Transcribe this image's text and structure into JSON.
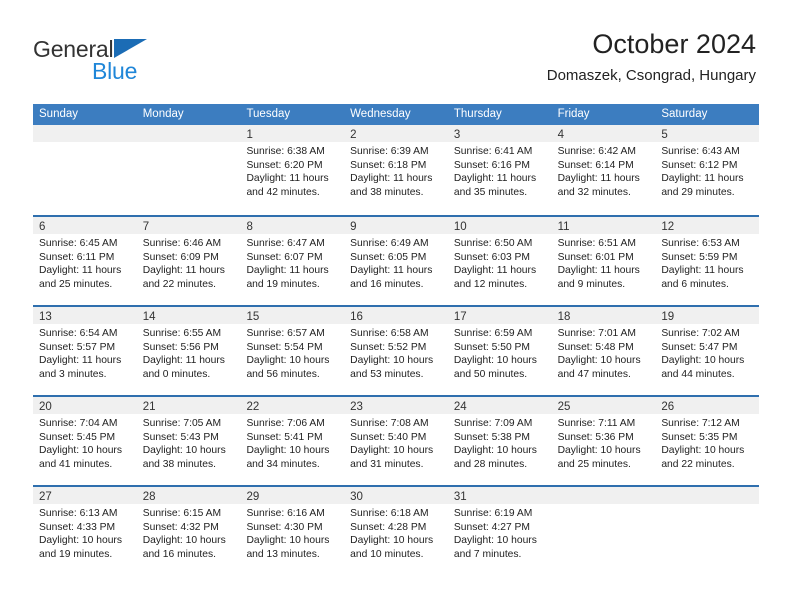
{
  "brand": {
    "name_part1": "General",
    "name_part2": "Blue",
    "triangle_color": "#1b6cb5",
    "blue_color": "#1f86d8"
  },
  "header": {
    "title": "October 2024",
    "subtitle": "Domaszek, Csongrad, Hungary"
  },
  "theme": {
    "header_bar_color": "#3c7dc0",
    "row_divider_color": "#2f6fae",
    "day_strip_color": "#f0f0f0",
    "text_color": "#222222"
  },
  "weekdays": [
    "Sunday",
    "Monday",
    "Tuesday",
    "Wednesday",
    "Thursday",
    "Friday",
    "Saturday"
  ],
  "weeks": [
    [
      {
        "day": "",
        "lines": []
      },
      {
        "day": "",
        "lines": []
      },
      {
        "day": "1",
        "lines": [
          "Sunrise: 6:38 AM",
          "Sunset: 6:20 PM",
          "Daylight: 11 hours",
          "and 42 minutes."
        ]
      },
      {
        "day": "2",
        "lines": [
          "Sunrise: 6:39 AM",
          "Sunset: 6:18 PM",
          "Daylight: 11 hours",
          "and 38 minutes."
        ]
      },
      {
        "day": "3",
        "lines": [
          "Sunrise: 6:41 AM",
          "Sunset: 6:16 PM",
          "Daylight: 11 hours",
          "and 35 minutes."
        ]
      },
      {
        "day": "4",
        "lines": [
          "Sunrise: 6:42 AM",
          "Sunset: 6:14 PM",
          "Daylight: 11 hours",
          "and 32 minutes."
        ]
      },
      {
        "day": "5",
        "lines": [
          "Sunrise: 6:43 AM",
          "Sunset: 6:12 PM",
          "Daylight: 11 hours",
          "and 29 minutes."
        ]
      }
    ],
    [
      {
        "day": "6",
        "lines": [
          "Sunrise: 6:45 AM",
          "Sunset: 6:11 PM",
          "Daylight: 11 hours",
          "and 25 minutes."
        ]
      },
      {
        "day": "7",
        "lines": [
          "Sunrise: 6:46 AM",
          "Sunset: 6:09 PM",
          "Daylight: 11 hours",
          "and 22 minutes."
        ]
      },
      {
        "day": "8",
        "lines": [
          "Sunrise: 6:47 AM",
          "Sunset: 6:07 PM",
          "Daylight: 11 hours",
          "and 19 minutes."
        ]
      },
      {
        "day": "9",
        "lines": [
          "Sunrise: 6:49 AM",
          "Sunset: 6:05 PM",
          "Daylight: 11 hours",
          "and 16 minutes."
        ]
      },
      {
        "day": "10",
        "lines": [
          "Sunrise: 6:50 AM",
          "Sunset: 6:03 PM",
          "Daylight: 11 hours",
          "and 12 minutes."
        ]
      },
      {
        "day": "11",
        "lines": [
          "Sunrise: 6:51 AM",
          "Sunset: 6:01 PM",
          "Daylight: 11 hours",
          "and 9 minutes."
        ]
      },
      {
        "day": "12",
        "lines": [
          "Sunrise: 6:53 AM",
          "Sunset: 5:59 PM",
          "Daylight: 11 hours",
          "and 6 minutes."
        ]
      }
    ],
    [
      {
        "day": "13",
        "lines": [
          "Sunrise: 6:54 AM",
          "Sunset: 5:57 PM",
          "Daylight: 11 hours",
          "and 3 minutes."
        ]
      },
      {
        "day": "14",
        "lines": [
          "Sunrise: 6:55 AM",
          "Sunset: 5:56 PM",
          "Daylight: 11 hours",
          "and 0 minutes."
        ]
      },
      {
        "day": "15",
        "lines": [
          "Sunrise: 6:57 AM",
          "Sunset: 5:54 PM",
          "Daylight: 10 hours",
          "and 56 minutes."
        ]
      },
      {
        "day": "16",
        "lines": [
          "Sunrise: 6:58 AM",
          "Sunset: 5:52 PM",
          "Daylight: 10 hours",
          "and 53 minutes."
        ]
      },
      {
        "day": "17",
        "lines": [
          "Sunrise: 6:59 AM",
          "Sunset: 5:50 PM",
          "Daylight: 10 hours",
          "and 50 minutes."
        ]
      },
      {
        "day": "18",
        "lines": [
          "Sunrise: 7:01 AM",
          "Sunset: 5:48 PM",
          "Daylight: 10 hours",
          "and 47 minutes."
        ]
      },
      {
        "day": "19",
        "lines": [
          "Sunrise: 7:02 AM",
          "Sunset: 5:47 PM",
          "Daylight: 10 hours",
          "and 44 minutes."
        ]
      }
    ],
    [
      {
        "day": "20",
        "lines": [
          "Sunrise: 7:04 AM",
          "Sunset: 5:45 PM",
          "Daylight: 10 hours",
          "and 41 minutes."
        ]
      },
      {
        "day": "21",
        "lines": [
          "Sunrise: 7:05 AM",
          "Sunset: 5:43 PM",
          "Daylight: 10 hours",
          "and 38 minutes."
        ]
      },
      {
        "day": "22",
        "lines": [
          "Sunrise: 7:06 AM",
          "Sunset: 5:41 PM",
          "Daylight: 10 hours",
          "and 34 minutes."
        ]
      },
      {
        "day": "23",
        "lines": [
          "Sunrise: 7:08 AM",
          "Sunset: 5:40 PM",
          "Daylight: 10 hours",
          "and 31 minutes."
        ]
      },
      {
        "day": "24",
        "lines": [
          "Sunrise: 7:09 AM",
          "Sunset: 5:38 PM",
          "Daylight: 10 hours",
          "and 28 minutes."
        ]
      },
      {
        "day": "25",
        "lines": [
          "Sunrise: 7:11 AM",
          "Sunset: 5:36 PM",
          "Daylight: 10 hours",
          "and 25 minutes."
        ]
      },
      {
        "day": "26",
        "lines": [
          "Sunrise: 7:12 AM",
          "Sunset: 5:35 PM",
          "Daylight: 10 hours",
          "and 22 minutes."
        ]
      }
    ],
    [
      {
        "day": "27",
        "lines": [
          "Sunrise: 6:13 AM",
          "Sunset: 4:33 PM",
          "Daylight: 10 hours",
          "and 19 minutes."
        ]
      },
      {
        "day": "28",
        "lines": [
          "Sunrise: 6:15 AM",
          "Sunset: 4:32 PM",
          "Daylight: 10 hours",
          "and 16 minutes."
        ]
      },
      {
        "day": "29",
        "lines": [
          "Sunrise: 6:16 AM",
          "Sunset: 4:30 PM",
          "Daylight: 10 hours",
          "and 13 minutes."
        ]
      },
      {
        "day": "30",
        "lines": [
          "Sunrise: 6:18 AM",
          "Sunset: 4:28 PM",
          "Daylight: 10 hours",
          "and 10 minutes."
        ]
      },
      {
        "day": "31",
        "lines": [
          "Sunrise: 6:19 AM",
          "Sunset: 4:27 PM",
          "Daylight: 10 hours",
          "and 7 minutes."
        ]
      },
      {
        "day": "",
        "lines": []
      },
      {
        "day": "",
        "lines": []
      }
    ]
  ]
}
